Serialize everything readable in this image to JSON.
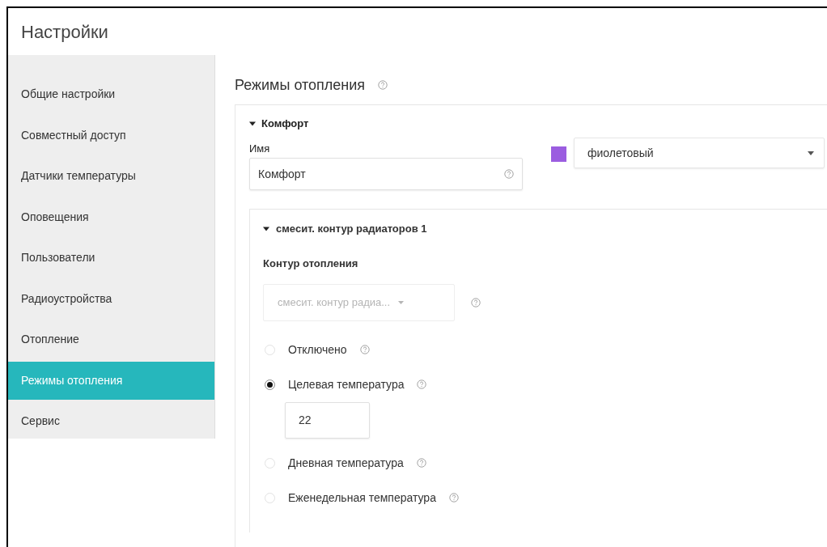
{
  "header": {
    "title": "Настройки"
  },
  "sidebar": {
    "items": [
      {
        "label": "Общие настройки",
        "selected": false
      },
      {
        "label": "Совместный доступ",
        "selected": false
      },
      {
        "label": "Датчики температуры",
        "selected": false
      },
      {
        "label": "Оповещения",
        "selected": false
      },
      {
        "label": "Пользователи",
        "selected": false
      },
      {
        "label": "Радиоустройства",
        "selected": false
      },
      {
        "label": "Отопление",
        "selected": false
      },
      {
        "label": "Режимы отопления",
        "selected": true
      },
      {
        "label": "Сервис",
        "selected": false
      }
    ]
  },
  "page": {
    "title": "Режимы отопления"
  },
  "mode": {
    "title": "Комфорт",
    "expanded": true,
    "name_label": "Имя",
    "name_value": "Комфорт",
    "color": "#9b5de0",
    "color_value": "фиолетовый"
  },
  "circuit": {
    "title": "смесит. контур радиаторов 1",
    "expanded": true,
    "label": "Контур отопления",
    "select_value": "смесит. контур радиа...",
    "select_disabled": true,
    "options": [
      {
        "label": "Отключено",
        "selected": false
      },
      {
        "label": "Целевая температура",
        "selected": true,
        "value": "22"
      },
      {
        "label": "Дневная температура",
        "selected": false
      },
      {
        "label": "Еженедельная температура",
        "selected": false
      }
    ]
  }
}
